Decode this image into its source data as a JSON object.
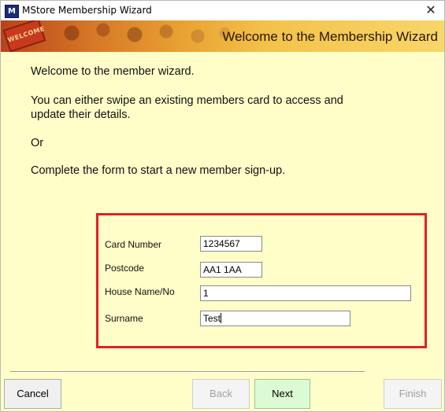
{
  "window": {
    "title": "MStore Membership Wizard",
    "app_icon_text": "M",
    "close_glyph": "✕"
  },
  "banner": {
    "logo_text": "WELCOME",
    "title": "Welcome to the Membership Wizard"
  },
  "intro": {
    "line1": "Welcome to the member wizard.",
    "line2a": "You can either swipe an existing members card to access and",
    "line2b": "update their details.",
    "line3": "Or",
    "line4": "Complete the form to start a new member sign-up."
  },
  "form": {
    "card_number_label": "Card Number",
    "card_number_value": "1234567",
    "postcode_label": "Postcode",
    "postcode_value": "AA1 1AA",
    "house_label": "House Name/No",
    "house_value": "1",
    "surname_label": "Surname",
    "surname_value": "Test",
    "highlight_color": "#e0202a"
  },
  "buttons": {
    "cancel": "Cancel",
    "back": "Back",
    "next": "Next",
    "finish": "Finish"
  },
  "colors": {
    "background": "#fffec8",
    "next_button": "#dcfbd4"
  }
}
